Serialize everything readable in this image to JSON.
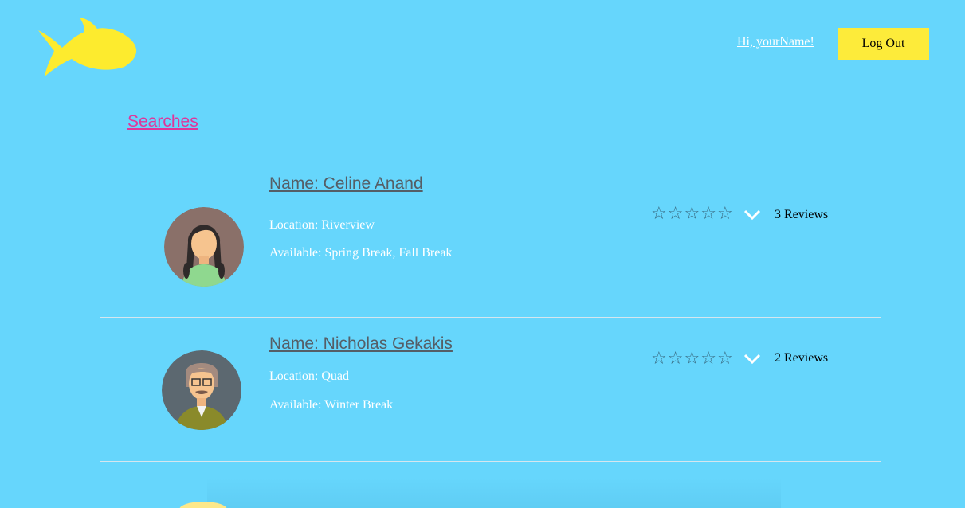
{
  "header": {
    "logo": "fish-logo",
    "greeting": "Hi, yourName!",
    "logout_label": "Log Out"
  },
  "nav": {
    "searches_label": "Searches"
  },
  "results": [
    {
      "name": "Name: Celine Anand",
      "location": "Location: Riverview",
      "available": "Available: Spring Break, Fall Break",
      "rating": 0,
      "reviews": "3 Reviews",
      "avatar": "female-avatar"
    },
    {
      "name": "Name: Nicholas Gekakis",
      "location": "Location: Quad",
      "available": "Available: Winter Break",
      "rating": 0,
      "reviews": "2 Reviews",
      "avatar": "male-avatar"
    }
  ],
  "colors": {
    "background": "#66d6fc",
    "accent": "#fdeb3a",
    "link": "#e0359a"
  }
}
